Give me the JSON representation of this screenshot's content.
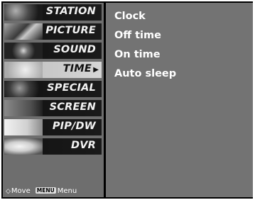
{
  "sidebar": {
    "items": [
      {
        "label": "STATION",
        "icon": "station-thumbnail-icon"
      },
      {
        "label": "PICTURE",
        "icon": "picture-thumbnail-icon"
      },
      {
        "label": "SOUND",
        "icon": "sound-thumbnail-icon"
      },
      {
        "label": "TIME",
        "icon": "time-thumbnail-icon",
        "selected": true
      },
      {
        "label": "SPECIAL",
        "icon": "special-thumbnail-icon"
      },
      {
        "label": "SCREEN",
        "icon": "screen-thumbnail-icon"
      },
      {
        "label": "PIP/DW",
        "icon": "pip-thumbnail-icon"
      },
      {
        "label": "DVR",
        "icon": "dvr-thumbnail-icon"
      }
    ],
    "selected_arrow": "▶"
  },
  "footer": {
    "move_icon": "◇",
    "move_label": "Move",
    "menu_key": "MENU",
    "menu_label": "Menu"
  },
  "submenu": {
    "options": [
      "Clock",
      "Off time",
      "On time",
      "Auto sleep"
    ]
  },
  "colors": {
    "frame": "#000000",
    "sidebar_bg": "#6e6e6e",
    "content_bg": "#737373",
    "item_bg": "#151515",
    "selected_bg": "#d0d0d0",
    "text": "#ffffff"
  }
}
